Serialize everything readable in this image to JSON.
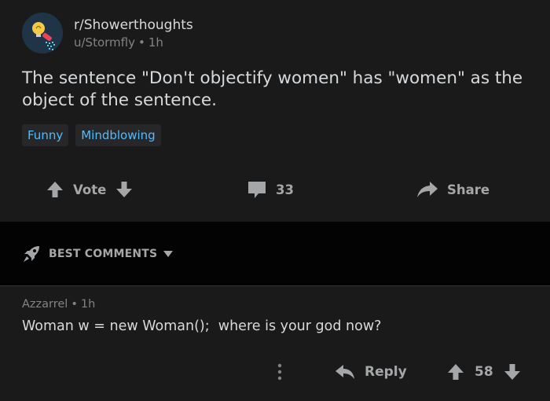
{
  "post": {
    "subreddit": "r/Showerthoughts",
    "author": "u/Stormfly",
    "age": "1h",
    "separator": "•",
    "title": "The sentence \"Don't objectify women\" has \"women\" as the object of the sentence.",
    "flairs": [
      "Funny",
      "Mindblowing"
    ],
    "actions": {
      "vote_label": "Vote",
      "comment_count": "33",
      "share_label": "Share"
    }
  },
  "sort": {
    "label": "BEST COMMENTS"
  },
  "comment": {
    "author": "Azzarrel",
    "age": "1h",
    "separator": "•",
    "body": "Woman w = new Woman();  where is your god now?",
    "reply_label": "Reply",
    "score": "58"
  },
  "colors": {
    "background": "#1a1a1b",
    "sort_bar": "#030303",
    "flair_text": "#4fbcff",
    "flair_bg": "#272729",
    "muted": "#818384",
    "text": "#d7dadc"
  },
  "icons": {
    "subreddit": "lightbulb-shower-icon",
    "upvote": "arrow-up-icon",
    "downvote": "arrow-down-icon",
    "comments": "speech-bubble-icon",
    "share": "share-arrow-icon",
    "sort": "rocket-icon",
    "caret": "caret-down-icon",
    "more": "vertical-dots-icon",
    "reply": "reply-arrow-icon"
  }
}
